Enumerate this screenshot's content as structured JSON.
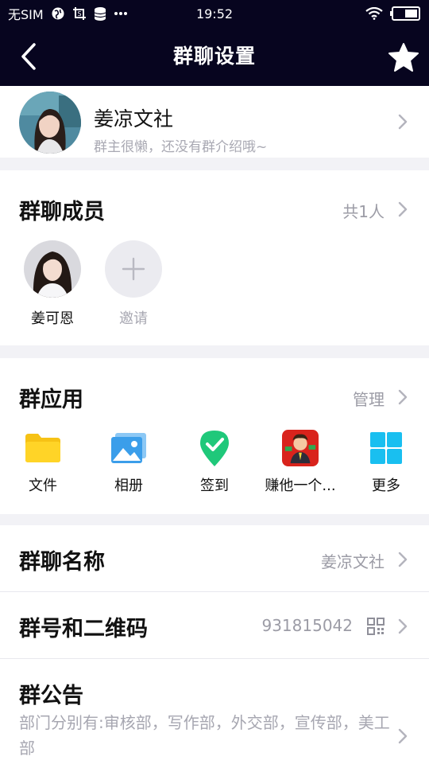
{
  "status_bar": {
    "carrier": "无SIM",
    "time": "19:52"
  },
  "nav": {
    "title": "群聊设置"
  },
  "group": {
    "name": "姜凉文社",
    "intro": "群主很懒，还没有群介绍哦~"
  },
  "members": {
    "title": "群聊成员",
    "count": "共1人",
    "items": [
      {
        "name": "姜可恩"
      },
      {
        "name": "邀请"
      }
    ]
  },
  "apps": {
    "title": "群应用",
    "manage": "管理",
    "items": [
      {
        "label": "文件",
        "icon": "folder-icon"
      },
      {
        "label": "相册",
        "icon": "photo-album-icon"
      },
      {
        "label": "签到",
        "icon": "check-in-icon"
      },
      {
        "label": "赚他一个...",
        "icon": "game-character-icon"
      },
      {
        "label": "更多",
        "icon": "grid-icon"
      }
    ]
  },
  "settings": {
    "group_name_label": "群聊名称",
    "group_name_value": "姜凉文社",
    "group_code_label": "群号和二维码",
    "group_code_value": "931815042",
    "notice_label": "群公告",
    "notice_text": "部门分别有:审核部，写作部，外交部，宣传部，美工部"
  },
  "colors": {
    "header_bg": "#07051f",
    "page_bg": "#f2f2f6",
    "muted_text": "#a7a7b1"
  }
}
